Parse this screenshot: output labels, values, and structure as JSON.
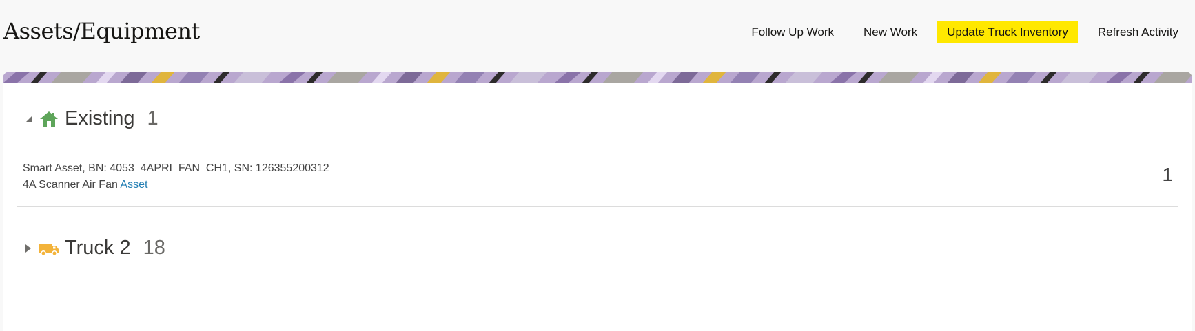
{
  "page": {
    "title": "Assets/Equipment"
  },
  "actions": [
    {
      "label": "Follow Up Work"
    },
    {
      "label": "New Work"
    },
    {
      "label": "Update Truck Inventory",
      "highlighted": true
    },
    {
      "label": "Refresh Activity"
    }
  ],
  "colors": {
    "highlight": "#ffe800",
    "home_icon": "#5ea55a",
    "truck_icon": "#f3b33a",
    "link": "#227eb3"
  },
  "groups": [
    {
      "title": "Existing",
      "count": "1",
      "icon": "home-icon",
      "expanded": true,
      "items": [
        {
          "line1": "Smart Asset, BN: 4053_4APRI_FAN_CH1, SN: 126355200312",
          "line2": "4A Scanner Air Fan",
          "link": "Asset",
          "quantity": "1"
        }
      ]
    },
    {
      "title": "Truck 2",
      "count": "18",
      "icon": "truck-icon",
      "expanded": false
    }
  ]
}
